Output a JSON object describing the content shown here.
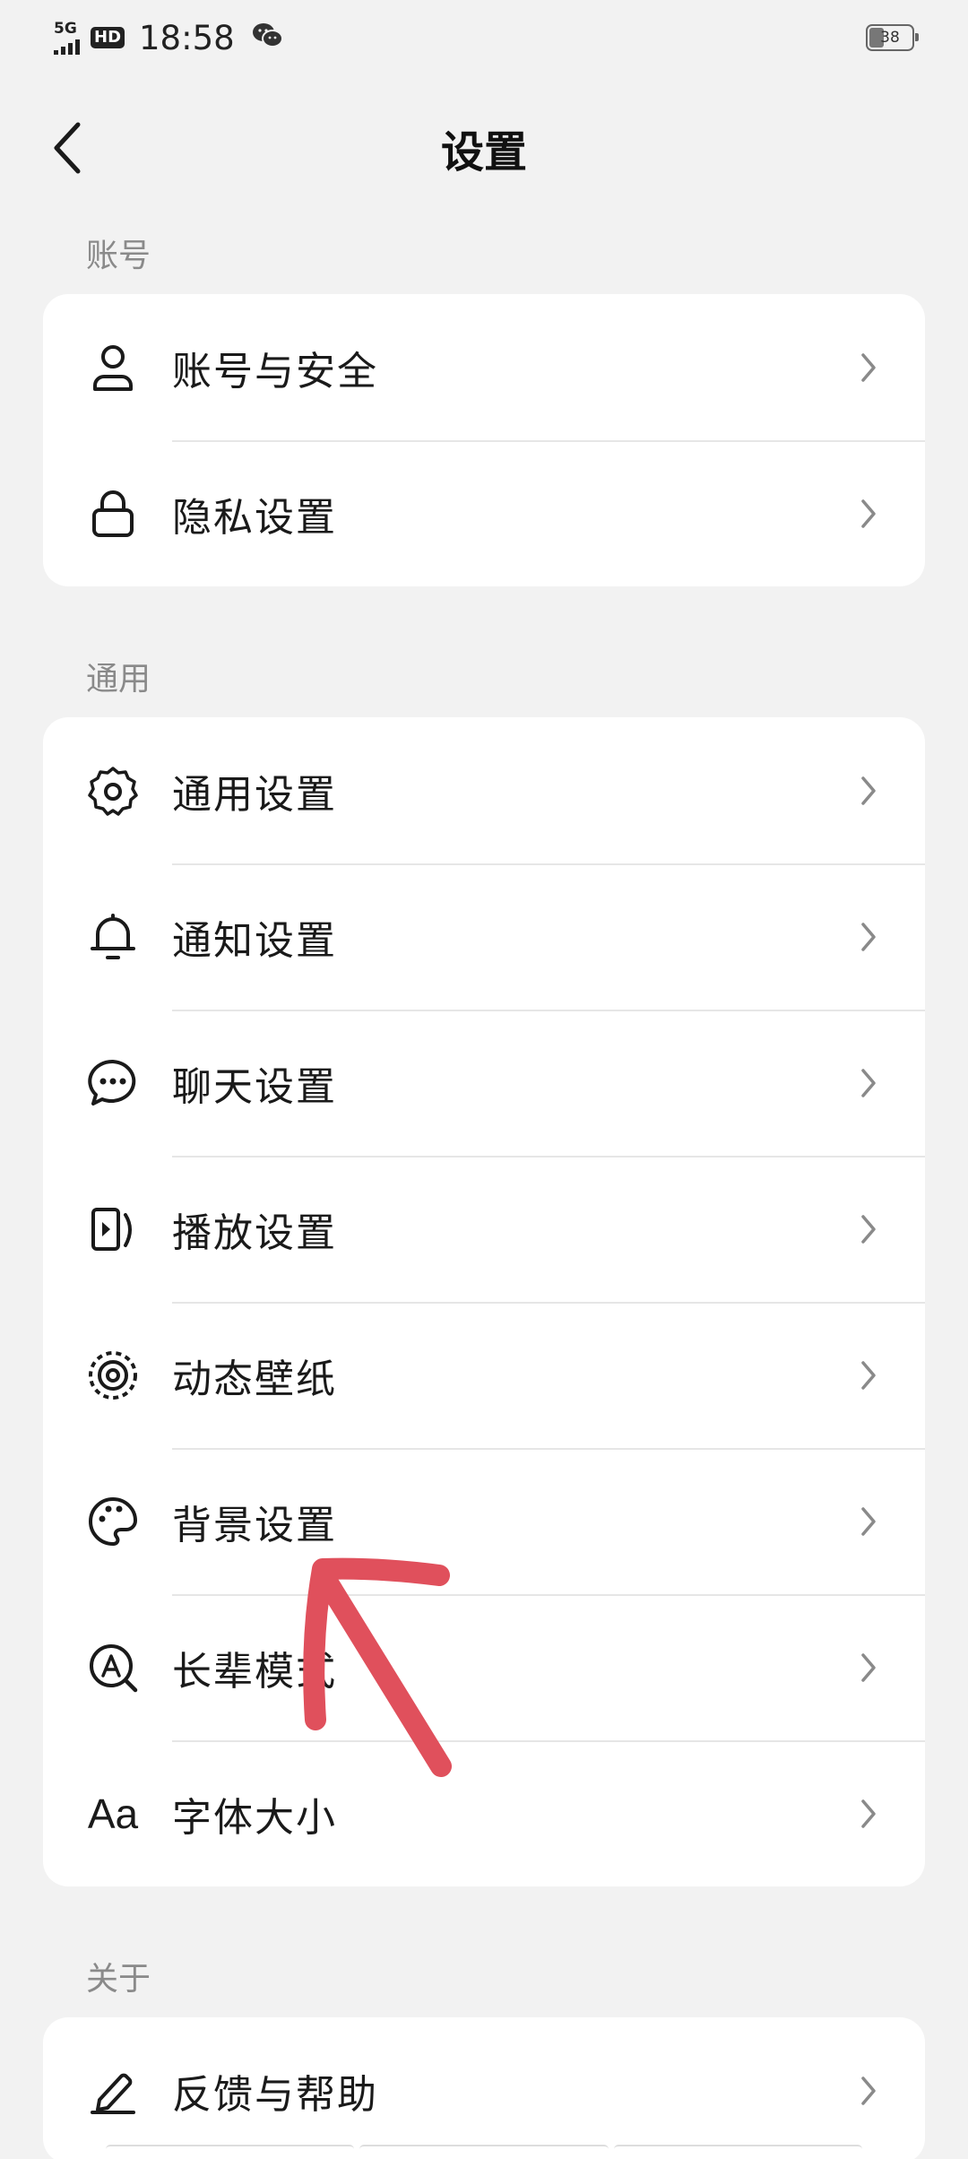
{
  "status_bar": {
    "network": "5G",
    "hd": "HD",
    "time": "18:58",
    "battery": "38"
  },
  "header": {
    "title": "设置",
    "back_icon": "chevron-left-icon"
  },
  "sections": {
    "account": {
      "label": "账号",
      "items": [
        {
          "label": "账号与安全",
          "icon": "person-icon"
        },
        {
          "label": "隐私设置",
          "icon": "lock-icon"
        }
      ]
    },
    "general": {
      "label": "通用",
      "items": [
        {
          "label": "通用设置",
          "icon": "gear-icon"
        },
        {
          "label": "通知设置",
          "icon": "bell-icon"
        },
        {
          "label": "聊天设置",
          "icon": "chat-bubble-icon"
        },
        {
          "label": "播放设置",
          "icon": "play-icon"
        },
        {
          "label": "动态壁纸",
          "icon": "wallpaper-icon"
        },
        {
          "label": "背景设置",
          "icon": "palette-icon"
        },
        {
          "label": "长辈模式",
          "icon": "elder-mode-icon"
        },
        {
          "label": "字体大小",
          "icon": "font-size-icon",
          "icon_text": "Aa"
        }
      ]
    },
    "about": {
      "label": "关于",
      "items": [
        {
          "label": "反馈与帮助",
          "icon": "pencil-icon"
        }
      ]
    }
  },
  "colors": {
    "background": "#f2f2f2",
    "card": "#ffffff",
    "section_label": "#8a8a8a",
    "annotation_arrow": "#e0505c"
  }
}
